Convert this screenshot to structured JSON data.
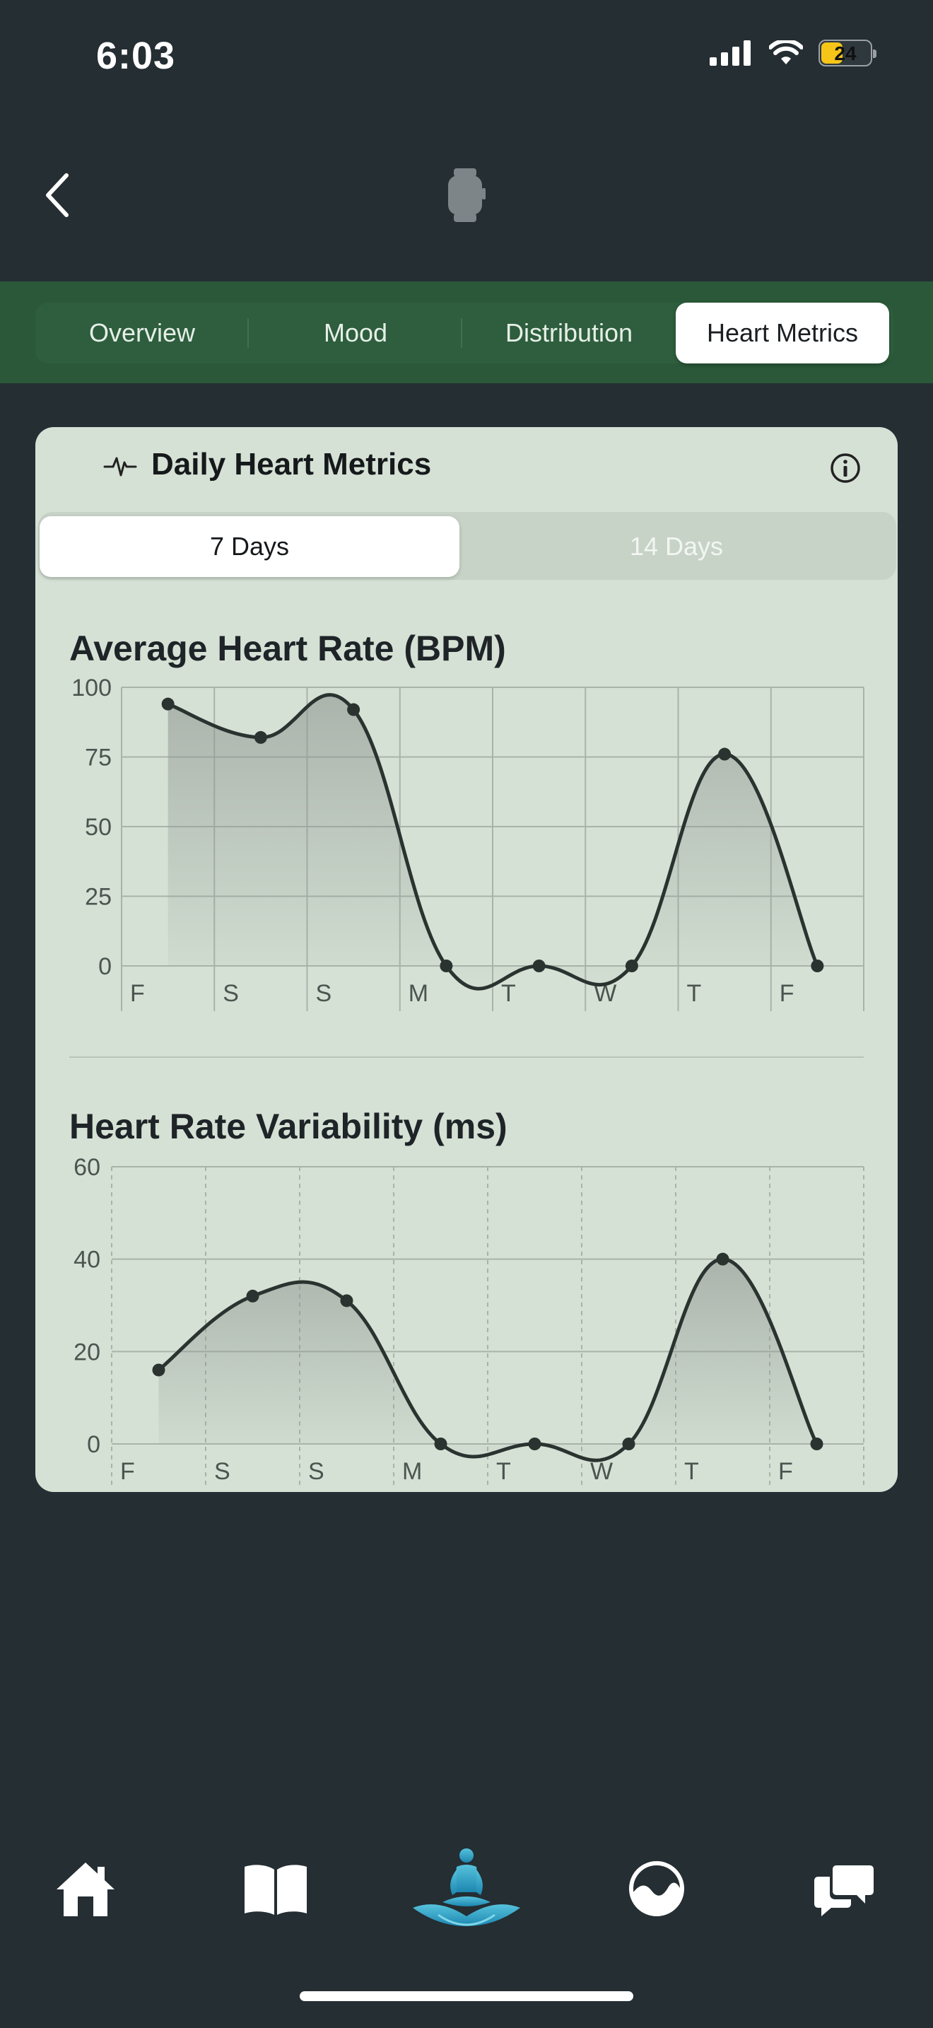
{
  "status_bar": {
    "time": "6:03",
    "battery": "24"
  },
  "header": {
    "back_icon": "chevron-left-icon",
    "device_icon": "watch-icon"
  },
  "tabs": [
    {
      "label": "Overview",
      "active": false
    },
    {
      "label": "Mood",
      "active": false
    },
    {
      "label": "Distribution",
      "active": false
    },
    {
      "label": "Heart Metrics",
      "active": true
    }
  ],
  "card": {
    "title": "Daily Heart Metrics",
    "icon": "heart-pulse-icon",
    "info_icon": "info-icon",
    "range_options": [
      {
        "label": "7 Days",
        "selected": true
      },
      {
        "label": "14 Days",
        "selected": false
      }
    ]
  },
  "chart_data": [
    {
      "type": "area",
      "title": "Average Heart Rate (BPM)",
      "categories": [
        "F",
        "S",
        "S",
        "M",
        "T",
        "W",
        "T",
        "F"
      ],
      "values": [
        94,
        82,
        92,
        0,
        0,
        0,
        76,
        0
      ],
      "ylim": [
        0,
        100
      ],
      "yticks": [
        0,
        25,
        50,
        75,
        100
      ],
      "grid": true
    },
    {
      "type": "area",
      "title": "Heart Rate Variability (ms)",
      "categories": [
        "F",
        "S",
        "S",
        "M",
        "T",
        "W",
        "T",
        "F"
      ],
      "values": [
        16,
        32,
        31,
        0,
        0,
        0,
        40,
        0
      ],
      "ylim": [
        0,
        60
      ],
      "yticks": [
        0,
        20,
        40,
        60
      ],
      "grid": true
    }
  ],
  "bottom_nav": [
    {
      "name": "home-icon"
    },
    {
      "name": "book-icon"
    },
    {
      "name": "meditation-icon"
    },
    {
      "name": "insights-icon"
    },
    {
      "name": "chat-icon"
    }
  ]
}
